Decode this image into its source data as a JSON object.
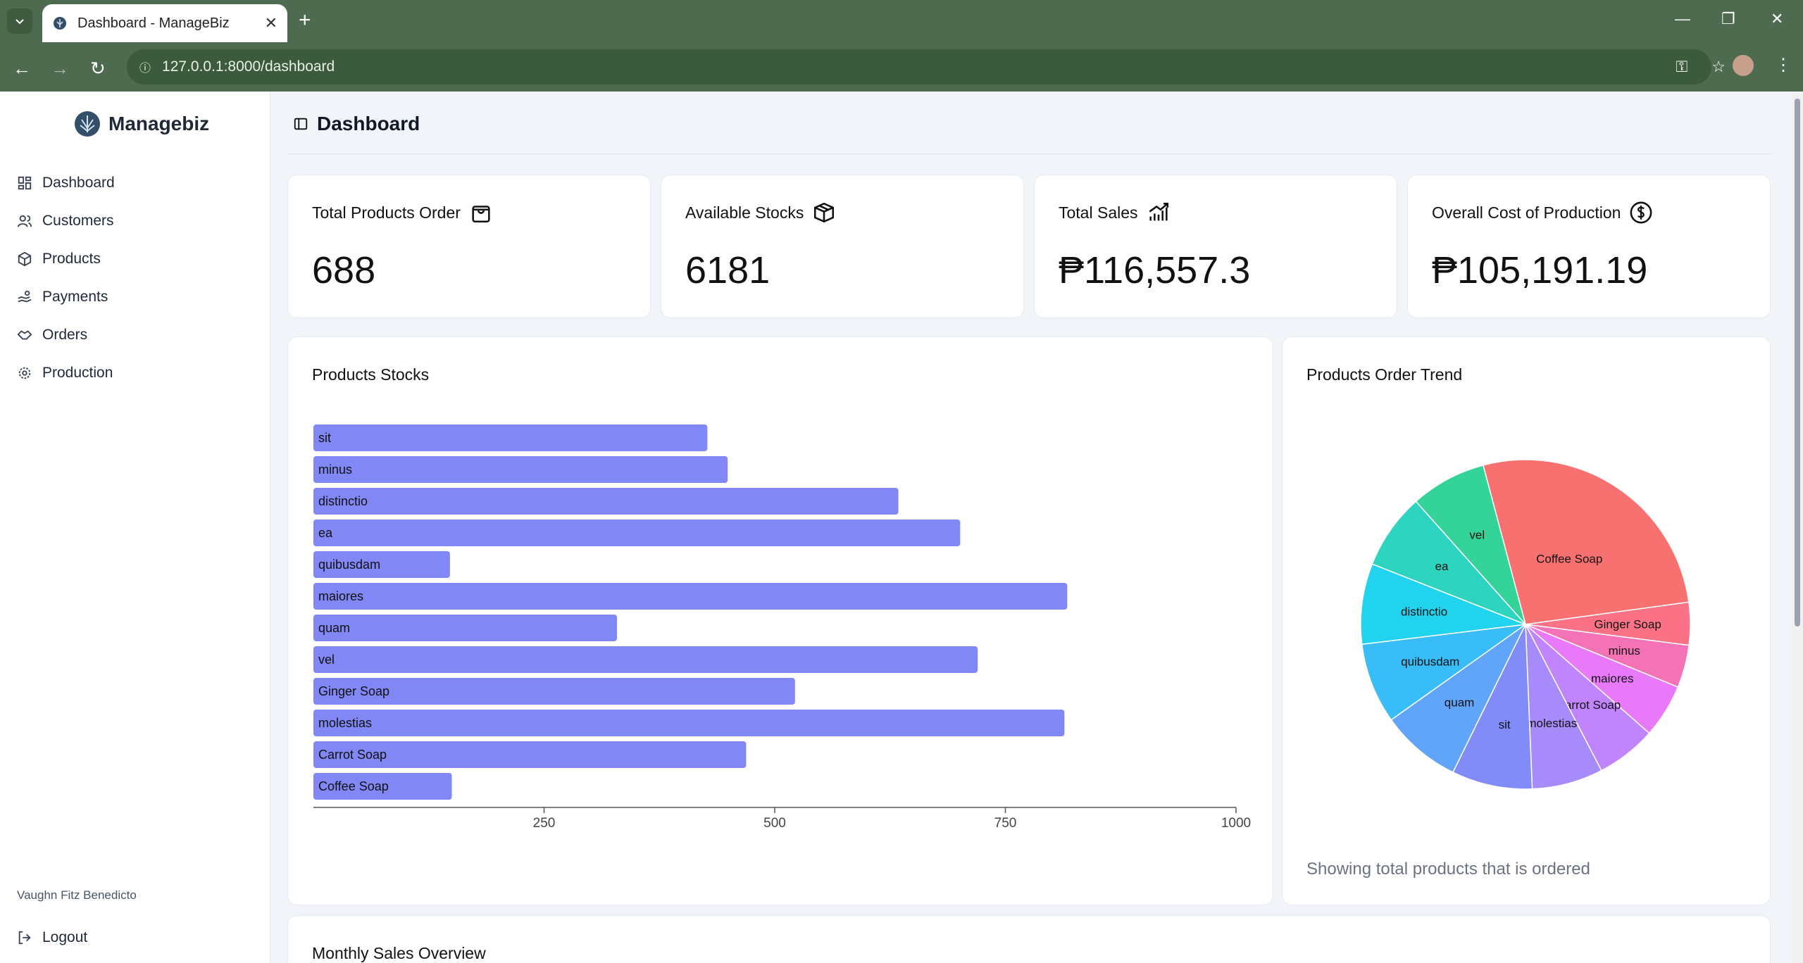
{
  "browser": {
    "tab_title": "Dashboard - ManageBiz",
    "url": "127.0.0.1:8000/dashboard"
  },
  "sidebar": {
    "brand": "Managebiz",
    "items": [
      {
        "label": "Dashboard",
        "icon": "layout-grid-icon"
      },
      {
        "label": "Customers",
        "icon": "users-icon"
      },
      {
        "label": "Products",
        "icon": "box-icon"
      },
      {
        "label": "Payments",
        "icon": "hand-coins-icon"
      },
      {
        "label": "Orders",
        "icon": "handshake-icon"
      },
      {
        "label": "Production",
        "icon": "cog-icon"
      }
    ],
    "user": "Vaughn Fitz Benedicto",
    "logout": "Logout"
  },
  "header": {
    "title": "Dashboard"
  },
  "stats": [
    {
      "label": "Total Products Order",
      "value": "688",
      "icon": "shopping-bag-icon"
    },
    {
      "label": "Available Stocks",
      "value": "6181",
      "icon": "package-icon"
    },
    {
      "label": "Total Sales",
      "value": "₱116,557.3",
      "icon": "chart-up-icon"
    },
    {
      "label": "Overall Cost of Production",
      "value": "₱105,191.19",
      "icon": "dollar-circle-icon"
    }
  ],
  "stocks_card": {
    "title": "Products Stocks"
  },
  "pie_card": {
    "title": "Products Order Trend",
    "caption": "Showing total products that is ordered"
  },
  "sales_card": {
    "title": "Monthly Sales Overview"
  },
  "colors": {
    "bar": "#8187f5",
    "brand": "#4f6b4f"
  },
  "chart_data": [
    {
      "type": "bar",
      "orientation": "horizontal",
      "categories": [
        "sit",
        "minus",
        "distinctio",
        "ea",
        "quibusdam",
        "maiores",
        "quam",
        "vel",
        "Ginger Soap",
        "molestias",
        "Carrot Soap",
        "Coffee Soap"
      ],
      "values": [
        427,
        449,
        634,
        701,
        148,
        817,
        329,
        720,
        522,
        814,
        469,
        150
      ],
      "ticks": [
        "250",
        "500",
        "750",
        "1000"
      ],
      "xlim": [
        0,
        1000
      ]
    },
    {
      "type": "pie",
      "labels": [
        "Coffee Soap",
        "Ginger Soap",
        "minus",
        "maiores",
        "Carrot Soap",
        "molestias",
        "sit",
        "quam",
        "quibusdam",
        "distinctio",
        "ea",
        "vel"
      ],
      "values": [
        174,
        27,
        27,
        34,
        38,
        45,
        51,
        51,
        51,
        51,
        48,
        48
      ],
      "colors": [
        "#f87171",
        "#fb7185",
        "#f472b6",
        "#e879f9",
        "#c084fc",
        "#a78bfa",
        "#818cf8",
        "#60a5fa",
        "#38bdf8",
        "#22d3ee",
        "#2dd4bf",
        "#34d399"
      ]
    }
  ]
}
